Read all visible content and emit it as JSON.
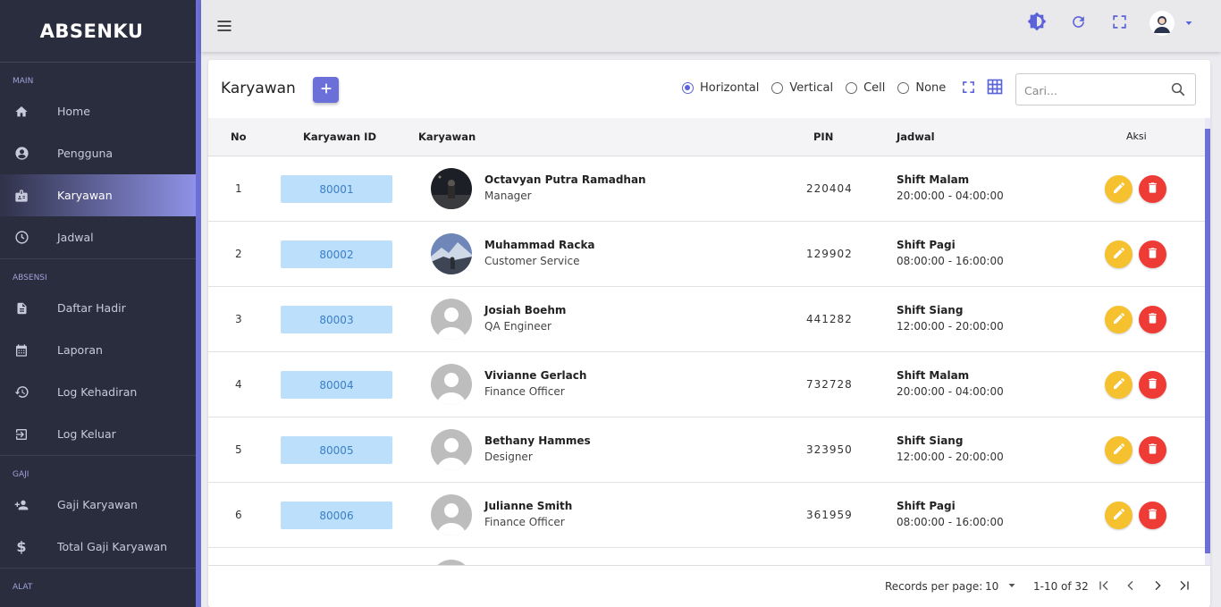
{
  "app": {
    "brand": "ABSENKU"
  },
  "sidebar": {
    "sections": [
      {
        "label": "MAIN"
      },
      {
        "label": "ABSENSI"
      },
      {
        "label": "GAJI"
      },
      {
        "label": "ALAT"
      }
    ],
    "items": [
      {
        "label": "Home",
        "icon": "home-icon"
      },
      {
        "label": "Pengguna",
        "icon": "account-circle-icon"
      },
      {
        "label": "Karyawan",
        "icon": "badge-icon",
        "active": true
      },
      {
        "label": "Jadwal",
        "icon": "clock-icon"
      },
      {
        "label": "Daftar Hadir",
        "icon": "document-icon"
      },
      {
        "label": "Laporan",
        "icon": "calendar-icon"
      },
      {
        "label": "Log Kehadiran",
        "icon": "history-icon"
      },
      {
        "label": "Log Keluar",
        "icon": "logout-icon"
      },
      {
        "label": "Gaji Karyawan",
        "icon": "person-add-icon"
      },
      {
        "label": "Total Gaji Karyawan",
        "icon": "dollar-icon"
      }
    ]
  },
  "page": {
    "title": "Karyawan",
    "grid_options": [
      "Horizontal",
      "Vertical",
      "Cell",
      "None"
    ],
    "grid_selected": "Horizontal",
    "search_placeholder": "Cari..."
  },
  "table": {
    "headers": {
      "no": "No",
      "id": "Karyawan ID",
      "karyawan": "Karyawan",
      "pin": "PIN",
      "jadwal": "Jadwal",
      "aksi": "Aksi"
    },
    "rows": [
      {
        "no": "1",
        "id": "80001",
        "name": "Octavyan Putra Ramadhan",
        "role": "Manager",
        "pin": "220404",
        "shift": "Shift Malam",
        "hours": "20:00:00 - 04:00:00",
        "avatar": "photo-night"
      },
      {
        "no": "2",
        "id": "80002",
        "name": "Muhammad Racka",
        "role": "Customer Service",
        "pin": "129902",
        "shift": "Shift Pagi",
        "hours": "08:00:00 - 16:00:00",
        "avatar": "photo-mountain"
      },
      {
        "no": "3",
        "id": "80003",
        "name": "Josiah Boehm",
        "role": "QA Engineer",
        "pin": "441282",
        "shift": "Shift Siang",
        "hours": "12:00:00 - 20:00:00",
        "avatar": "default"
      },
      {
        "no": "4",
        "id": "80004",
        "name": "Vivianne Gerlach",
        "role": "Finance Officer",
        "pin": "732728",
        "shift": "Shift Malam",
        "hours": "20:00:00 - 04:00:00",
        "avatar": "default"
      },
      {
        "no": "5",
        "id": "80005",
        "name": "Bethany Hammes",
        "role": "Designer",
        "pin": "323950",
        "shift": "Shift Siang",
        "hours": "12:00:00 - 20:00:00",
        "avatar": "default"
      },
      {
        "no": "6",
        "id": "80006",
        "name": "Julianne Smith",
        "role": "Finance Officer",
        "pin": "361959",
        "shift": "Shift Pagi",
        "hours": "08:00:00 - 16:00:00",
        "avatar": "default"
      }
    ]
  },
  "footer": {
    "records_label": "Records per page:",
    "records_value": "10",
    "range": "1-10 of 32"
  },
  "colors": {
    "sidebar_bg": "#2a2d3e",
    "accent": "#6b6fd8",
    "id_badge_bg": "#bcdffb",
    "edit": "#f5c12e",
    "delete": "#ee3b36"
  }
}
